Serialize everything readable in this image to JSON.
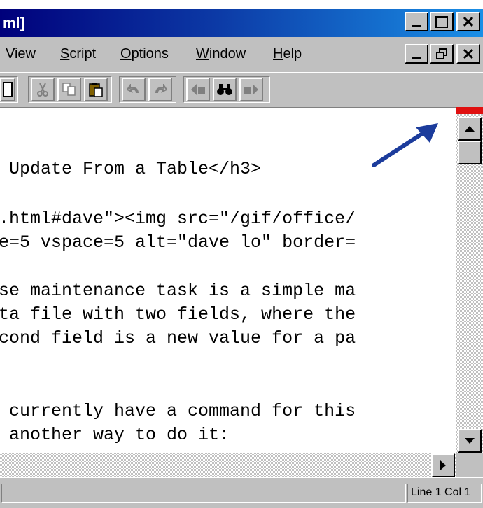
{
  "window": {
    "title": "ml]"
  },
  "menu": {
    "items": [
      {
        "label": "View",
        "underline": ""
      },
      {
        "label": "Script",
        "underline": "S"
      },
      {
        "label": "Options",
        "underline": "O"
      },
      {
        "label": "Window",
        "underline": "W"
      },
      {
        "label": "Help",
        "underline": "H"
      }
    ]
  },
  "toolbar": {
    "buttons": [
      "document-icon",
      "cut-icon",
      "copy-icon",
      "paste-icon",
      "undo-icon",
      "redo-icon",
      "find-previous-icon",
      "find-icon",
      "find-next-icon"
    ]
  },
  "editor": {
    "lines": [
      " Update From a Table</h3>",
      ".html#dave\"><img src=\"/gif/office/",
      "e=5 vspace=5 alt=\"dave lo\" border=",
      "se maintenance task is a simple ma",
      "ta file with two fields, where the",
      "cond field is a new value for a pa",
      " currently have a command for this",
      " another way to do it:"
    ]
  },
  "status": {
    "position": "Line 1 Col 1"
  },
  "colors": {
    "annotation_arrow": "#1c3c9c",
    "scroll_marker": "#e01010"
  }
}
